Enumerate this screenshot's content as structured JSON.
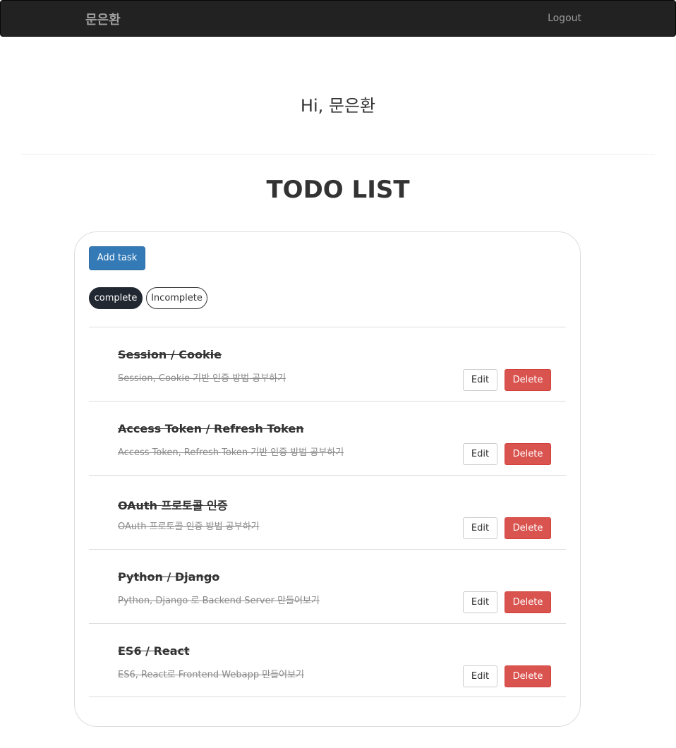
{
  "navbar": {
    "brand": "문은환",
    "logout_label": "Logout"
  },
  "greeting": "Hi, 문은환",
  "page_title": "TODO LIST",
  "toolbar": {
    "add_task_label": "Add task"
  },
  "filters": {
    "complete_label": "complete",
    "incomplete_label": "Incomplete",
    "active": "complete"
  },
  "colors": {
    "navbar_bg": "#222222",
    "primary": "#337ab7",
    "danger": "#d9534f",
    "active_filter": "#222831"
  },
  "tasks": [
    {
      "title": "Session / Cookie",
      "description": "Session, Cookie 기반 인증 방법 공부하기",
      "completed": true,
      "edit_label": "Edit",
      "delete_label": "Delete"
    },
    {
      "title": "Access Token / Refresh Token",
      "description": "Access Token, Refresh Token 기반 인증 방법 공부하기",
      "completed": true,
      "edit_label": "Edit",
      "delete_label": "Delete"
    },
    {
      "title": "OAuth 프로토콜 인증",
      "description": "OAuth 프로토콜 인증 방법 공부하기",
      "completed": true,
      "edit_label": "Edit",
      "delete_label": "Delete"
    },
    {
      "title": "Python / Django",
      "description": "Python, Django 로 Backend Server 만들어보기",
      "completed": true,
      "edit_label": "Edit",
      "delete_label": "Delete"
    },
    {
      "title": "ES6 / React",
      "description": "ES6, React로 Frontend Webapp 만들어보기",
      "completed": true,
      "edit_label": "Edit",
      "delete_label": "Delete"
    }
  ]
}
